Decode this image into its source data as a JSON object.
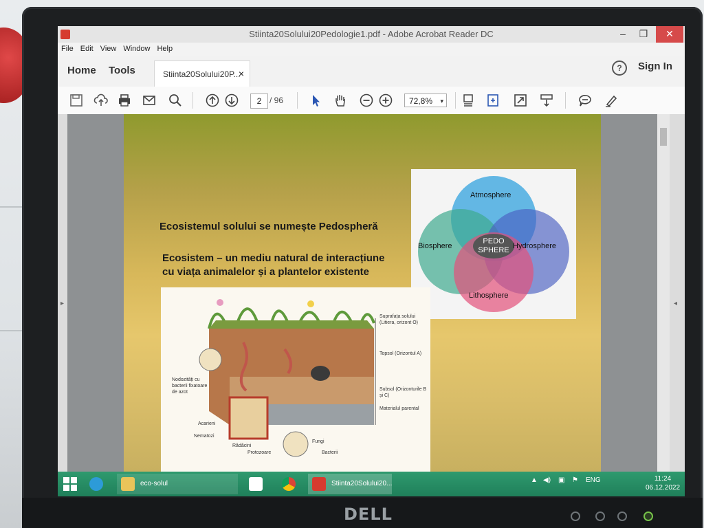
{
  "window": {
    "title": "Stiinta20Solului20Pedologie1.pdf - Adobe Acrobat Reader DC",
    "minimize": "–",
    "maximize": "❐",
    "close": "✕"
  },
  "menubar": [
    "File",
    "Edit",
    "View",
    "Window",
    "Help"
  ],
  "tabs": {
    "home": "Home",
    "tools": "Tools",
    "document": "Stiinta20Solului20P...",
    "document_close": "×",
    "help": "?",
    "sign_in": "Sign In"
  },
  "toolbar": {
    "current_page": "2",
    "total_pages": "/ 96",
    "zoom": "72,8%",
    "zoom_caret": "▾"
  },
  "slide": {
    "heading": "Ecosistemul solului se numește Pedospheră",
    "definition_line1": "Ecosistem – un mediu natural de interacțiune",
    "definition_line2": "cu viața animalelor și a plantelor  existente",
    "venn": {
      "atmosphere": "Atmosphere",
      "biosphere": "Biosphere",
      "hydrosphere": "Hydrosphere",
      "lithosphere": "Lithosphere",
      "center_line1": "PEDO",
      "center_line2": "SPHERE",
      "colors": {
        "atmosphere": "#3fa7e0",
        "biosphere": "#3fa98f",
        "hydrosphere": "#4a5fc2",
        "lithosphere": "#e2517a",
        "center": "#555555"
      }
    },
    "soil_labels": {
      "surface": "Suprafața solului (Litiera, orizont O)",
      "topsoil": "Topsol (Orizontul A)",
      "subsoil": "Subsol (Orizonturile B și C)",
      "parent": "Materialul parental",
      "nodules": "Nodozități cu bacterii fixatoare de azot",
      "mites": "Acarieni",
      "nematodes": "Nematozi",
      "roots": "Rădăcini",
      "protozoa": "Protozoare",
      "fungi": "Fungi",
      "bacteria": "Bacterii"
    }
  },
  "taskbar": {
    "explorer_label": "eco-solul",
    "pdf_label": "Stiinta20Solului20...",
    "language": "ENG",
    "time": "11:24",
    "date": "06.12.2022",
    "accent": "#2a9068"
  },
  "monitor": {
    "brand": "DELL"
  }
}
